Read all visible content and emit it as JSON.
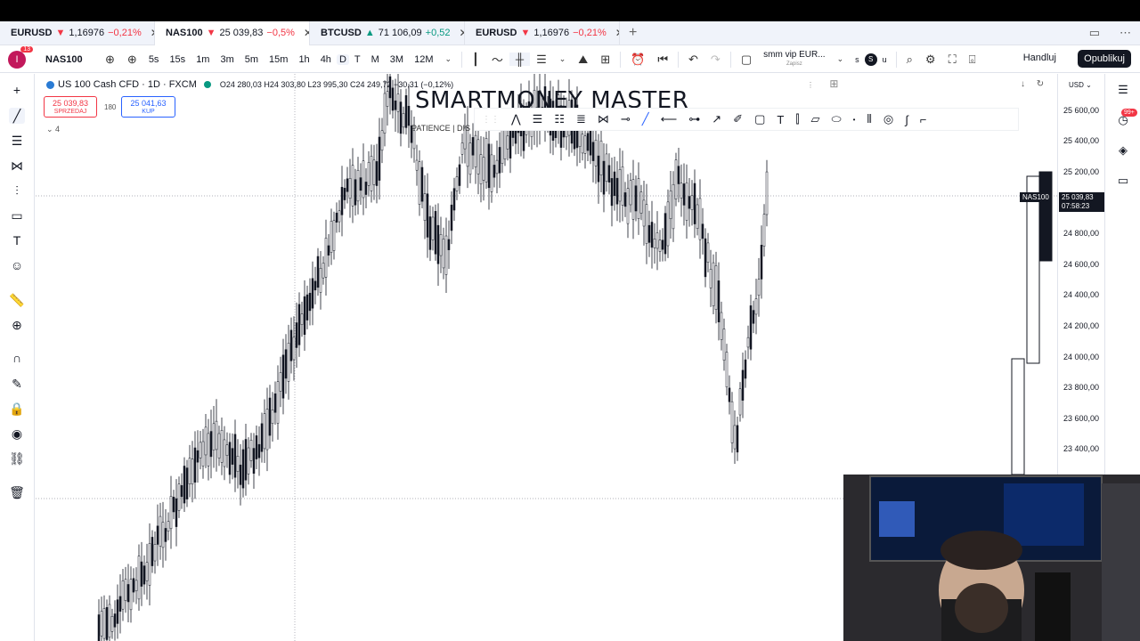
{
  "tabs": [
    {
      "symbol": "EURUSD",
      "arrow": "▼",
      "price": "1,16976",
      "change": "−0,21%",
      "dir": "down",
      "icon_color": "#2962ff",
      "active": false
    },
    {
      "symbol": "NAS100",
      "arrow": "▼",
      "price": "25 039,83",
      "change": "−0,5%",
      "dir": "down",
      "icon_color": "#2a7bd4",
      "active": true
    },
    {
      "symbol": "BTCUSD",
      "arrow": "▲",
      "price": "71 106,09",
      "change": "+0,52",
      "dir": "up",
      "icon_color": "#f7931a",
      "active": false
    },
    {
      "symbol": "EURUSD",
      "arrow": "▼",
      "price": "1,16976",
      "change": "−0,21%",
      "dir": "down",
      "icon_color": "#2962ff",
      "active": false
    }
  ],
  "toolbar": {
    "notification_count": "13",
    "symbol": "NAS100",
    "timeframes": [
      "5s",
      "15s",
      "1m",
      "3m",
      "5m",
      "15m",
      "1h",
      "4h",
      "D",
      "T",
      "M",
      "3M",
      "12M"
    ],
    "active_timeframe": "D",
    "layout_name": "smm vip EUR...",
    "layout_sub": "Zapisz",
    "s_label": "S",
    "s_text": "s",
    "u_text": "u",
    "trade_label": "Handluj",
    "publish_label": "Opublikuj"
  },
  "legend": {
    "title": "US 100 Cash CFD · 1D · FXCM",
    "ohlc": "O24 280,03  H24 303,80  L23 995,30  C24 249,72  −30,31 (−0,12%)",
    "sell_price": "25 039,83",
    "sell_label": "SPRZEDAJ",
    "spread": "180",
    "buy_price": "25 041,63",
    "buy_label": "KUP",
    "indicators_count": "4"
  },
  "watermark": {
    "title": "SMARTMONEY MASTER",
    "subtitle": "PATIENCE  |  DIS"
  },
  "price_axis": {
    "currency": "USD",
    "labels": [
      "25 600,00",
      "25 400,00",
      "25 200,00",
      "24 800,00",
      "24 600,00",
      "24 400,00",
      "24 200,00",
      "24 000,00",
      "23 800,00",
      "23 600,00",
      "23 400,00"
    ],
    "current_price": "25 039,83",
    "countdown": "07:58:23",
    "symbol_tag": "NAS100"
  },
  "right_toolbar": {
    "badge": "99+"
  },
  "colors": {
    "down": "#f23645",
    "up": "#089981",
    "accent": "#2962ff",
    "dark": "#131722"
  }
}
